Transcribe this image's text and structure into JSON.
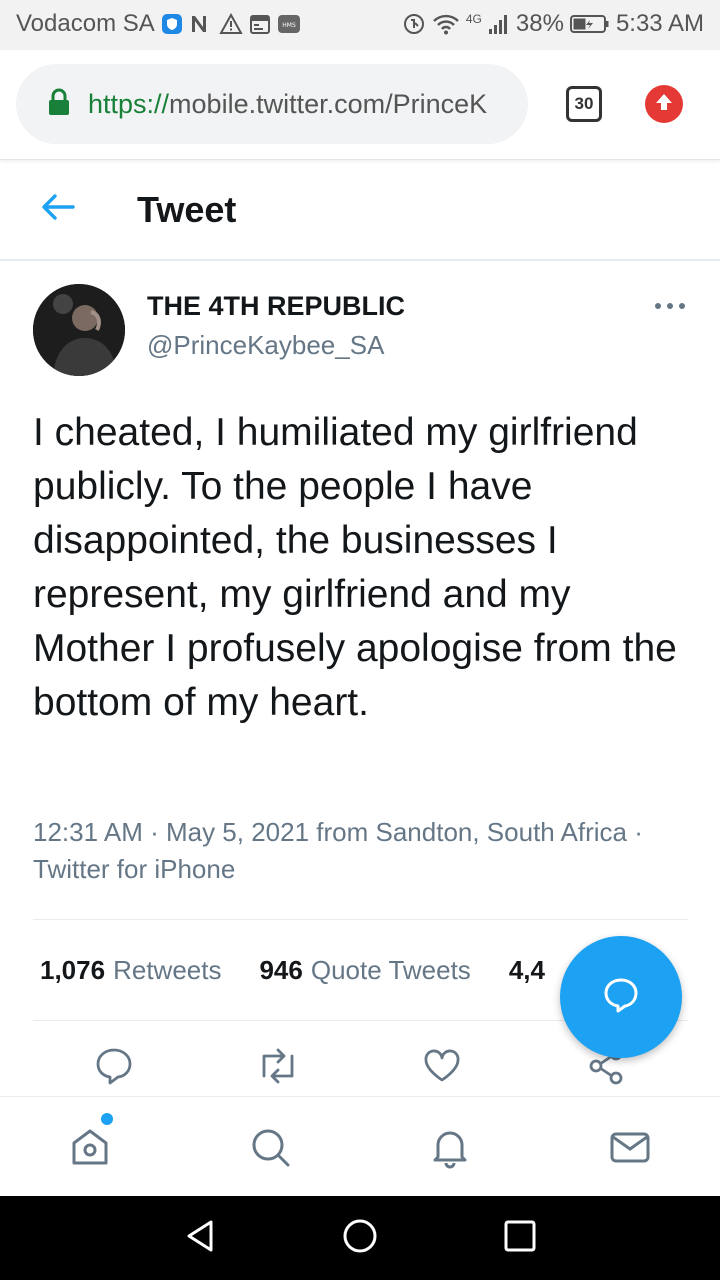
{
  "status_bar": {
    "carrier": "Vodacom SA",
    "network_label": "4G",
    "battery": "38%",
    "time": "5:33 AM"
  },
  "browser": {
    "url_scheme": "https://",
    "url_rest": "mobile.twitter.com/PrinceK",
    "tab_count": "30"
  },
  "header": {
    "title": "Tweet"
  },
  "tweet": {
    "display_name": "THE 4TH REPUBLIC",
    "handle": "@PrinceKaybee_SA",
    "text": "I cheated, I humiliated my girlfriend publicly. To the people I have disappointed, the businesses I represent, my girlfriend and my Mother I profusely apologise from the bottom of my heart.",
    "meta": "12:31 AM · May 5, 2021 from Sandton, South Africa · Twitter for iPhone"
  },
  "stats": {
    "retweets_count": "1,076",
    "retweets_label": "Retweets",
    "quotes_count": "946",
    "quotes_label": "Quote Tweets",
    "likes_count": "4,4"
  },
  "colors": {
    "accent": "#1da1f2",
    "text_primary": "#14171a",
    "text_secondary": "#657786",
    "secure_green": "#188038",
    "update_red": "#e53935"
  },
  "icons": {
    "back": "arrow-left-icon",
    "more": "more-horizontal-icon",
    "reply": "reply-icon",
    "retweet": "retweet-icon",
    "like": "heart-icon",
    "share": "share-icon",
    "compose": "compose-reply-icon",
    "home": "home-icon",
    "search": "search-icon",
    "notifications": "bell-icon",
    "messages": "mail-icon"
  }
}
